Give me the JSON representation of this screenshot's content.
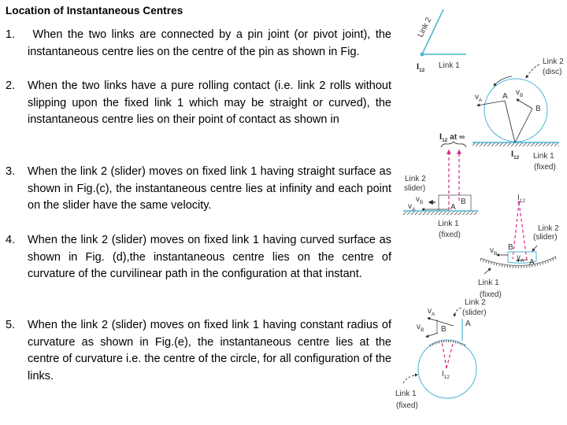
{
  "title": "Location of Instantaneous Centres",
  "items": [
    {
      "num": "1.",
      "text": " When the two links are connected by a pin joint (or pivot joint), the instantaneous centre lies on the centre of the pin as shown in Fig."
    },
    {
      "num": "2.",
      "text": "When the two links have a pure rolling contact (i.e. link 2 rolls without slipping upon the fixed link 1 which may be straight or curved), the instantaneous centre lies on their point of contact as shown in"
    },
    {
      "num": "3.",
      "text": "When the link 2 (slider) moves on fixed link 1 having straight surface as shown in Fig.(c), the instantaneous centre lies at infinity and each point on the slider have the same velocity."
    },
    {
      "num": "4.",
      "text": "When the link 2 (slider) moves on fixed link 1 having curved surface as shown in Fig. (d),the instantaneous centre lies on the centre of curvature of the curvilinear path in the configuration at that instant."
    },
    {
      "num": "5.",
      "text": "When the link 2 (slider) moves on fixed link 1 having constant radius of curvature as shown in Fig.(e), the instantaneous centre lies at the centre of curvature i.e. the centre of the circle, for all configuration of the links."
    }
  ],
  "figures": {
    "colors": {
      "link": "#4ab3d6",
      "ic_line": "#d6298a",
      "ink": "#222222"
    },
    "fig_a": {
      "link2": "Link 2",
      "link1": "Link 1",
      "ic": "I",
      "ic_sub": "12"
    },
    "fig_b": {
      "disc_label": "Link 2",
      "disc_sub": "(disc)",
      "va": "v",
      "va_sub": "A",
      "vb": "v",
      "vb_sub": "B",
      "point_a": "A",
      "point_b": "B",
      "ic": "I",
      "ic_sub": "12",
      "link1": "Link 1",
      "link1_sub": "(fixed)"
    },
    "fig_c": {
      "ic": "I",
      "ic_sub": "12",
      "ic_suffix": "at ∞",
      "slider_label": "Link 2",
      "slider_sub": "slider)",
      "vb": "v",
      "vb_sub": "B",
      "va": "v",
      "va_sub": "A",
      "point_a": "A",
      "point_b": "B",
      "link1": "Link 1",
      "link1_sub": "(fixed)"
    },
    "fig_d": {
      "ic": "I",
      "ic_sub": "12",
      "slider_label": "Link 2",
      "slider_sub": "(slider)",
      "vb": "v",
      "vb_sub": "B",
      "va": "v",
      "va_sub": "A",
      "point_a": "A",
      "point_b": "B",
      "link1": "Link 1",
      "link1_sub": "(fixed)"
    },
    "fig_e": {
      "slider_label": "Link 2",
      "slider_sub": "(slider)",
      "va": "v",
      "va_sub": "A",
      "vb": "v",
      "vb_sub": "B",
      "point_a": "A",
      "point_b": "B",
      "ic": "I",
      "ic_sub": "12",
      "link1": "Link 1",
      "link1_sub": "(fixed)"
    }
  }
}
